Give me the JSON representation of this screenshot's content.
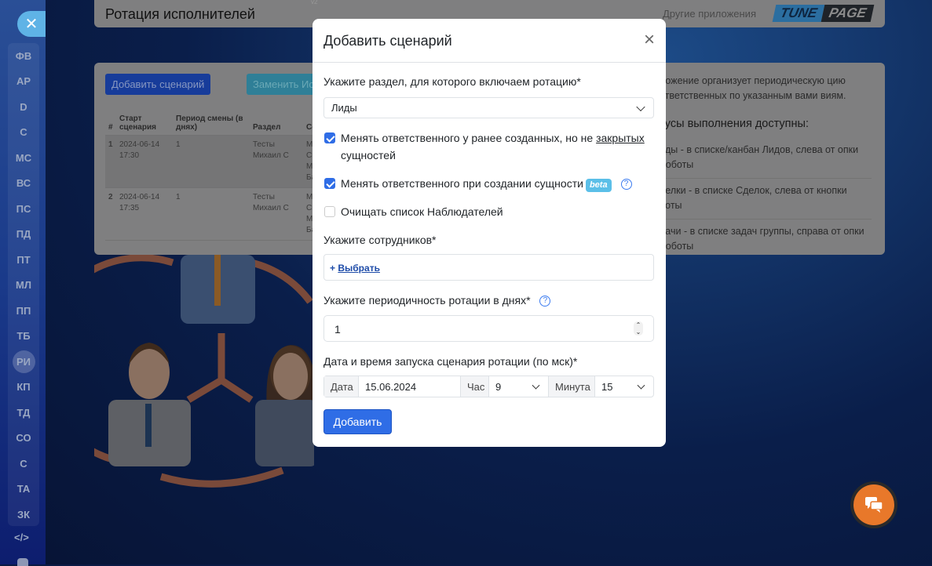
{
  "sidebar": {
    "close": "✕",
    "items": [
      "ФВ",
      "АР",
      "D",
      "С",
      "МС",
      "ВС",
      "ПС",
      "ПД",
      "ПТ",
      "МЛ",
      "ПП",
      "ТБ",
      "РИ",
      "КП",
      "ТД",
      "СО",
      "С",
      "ТА",
      "ЗК"
    ],
    "active": "РИ",
    "code": "</>"
  },
  "header": {
    "title": "Ротация исполнителей",
    "version": "v2",
    "other_apps": "Другие приложения",
    "logo_left": "TUNE",
    "logo_right": "PAGE"
  },
  "toolbar": {
    "add_scenario": "Добавить сценарий",
    "replace": "Заменить Исполнителя"
  },
  "table": {
    "headers": [
      "#",
      "Старт сценария",
      "Период смены (в днях)",
      "Раздел",
      "Со"
    ],
    "rows": [
      {
        "n": "1",
        "start": "2024-06-14 17:30",
        "period": "1",
        "section": "Тесты Михаил С",
        "emp": "М Ск М Ба"
      },
      {
        "n": "2",
        "start": "2024-06-14 17:35",
        "period": "1",
        "section": "Тесты Михаил С",
        "emp": "М Ск М Ба"
      }
    ]
  },
  "info": {
    "intro": "ложение организует периодическую цию ответственных по указанным вами виям.",
    "heading": "тусы выполнения доступны:",
    "items": [
      "иды - в списке/канбан Лидов, слева от опки Роботы",
      "делки - в списке Сделок, слева от кнопки боты",
      "дачи - в списке задач группы, справа от опки Роботы"
    ]
  },
  "modal": {
    "title": "Добавить сценарий",
    "close": "×",
    "section_label": "Укажите раздел, для которого включаем ротацию*",
    "section_value": "Лиды",
    "cb1_text": "Менять ответственного у ранее созданных, но не ",
    "cb1_link": "закрытых",
    "cb1_tail": "сущностей",
    "cb1_checked": true,
    "cb2_text": "Менять ответственного при создании сущности",
    "cb2_badge": "beta",
    "cb2_checked": true,
    "cb3_text": "Очищать список Наблюдателей",
    "cb3_checked": false,
    "help": "?",
    "employees_label": "Укажите сотрудников*",
    "employees_plus": "+",
    "employees_link": "Выбрать",
    "period_label": "Укажите периодичность ротации в днях*",
    "period_value": "1",
    "datetime_label": "Дата и время запуска сценария ротации (по мск)*",
    "date_addon": "Дата",
    "date_value": "15.06.2024",
    "hour_addon": "Час",
    "hour_value": "9",
    "minute_addon": "Минута",
    "minute_value": "15",
    "submit": "Добавить"
  },
  "colors": {
    "primary": "#2f6de6",
    "beta": "#5bbfe8",
    "chat": "#e8782a"
  }
}
